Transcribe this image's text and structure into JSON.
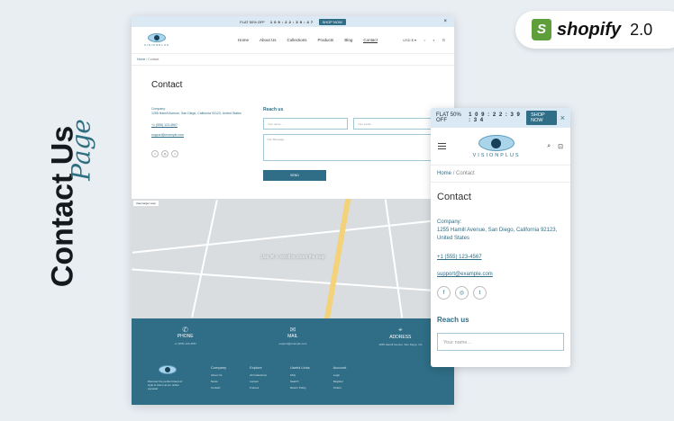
{
  "side": {
    "title": "Contact Us",
    "subtitle": "Page"
  },
  "badge": {
    "brand": "shopify",
    "version": "2.0"
  },
  "desktop": {
    "announcement": {
      "text": "FLAT 50% OFF",
      "countdown": "1 0 9 : 2 2 : 3 9 : 4 7",
      "button": "SHOP NOW",
      "close": "×"
    },
    "logo_text": "VISIONPLUS",
    "menu": [
      "Home",
      "About Us",
      "Collections",
      "Products",
      "Blog",
      "Contact"
    ],
    "tools": [
      "USD $ ▾",
      "○",
      "⌕",
      "⊡"
    ],
    "breadcrumb": {
      "home": "Home",
      "current": "Contact"
    },
    "title": "Contact",
    "info": {
      "label": "Company:",
      "address": "1255 Hamill Avenue, San Diego, California 92123, United States",
      "phone": "+1 (555) 123-4567",
      "email": "support@example.com"
    },
    "social": [
      "f",
      "◎",
      "t"
    ],
    "form": {
      "heading": "Reach us",
      "name_placeholder": "Your name...",
      "email_placeholder": "Your email...",
      "message_placeholder": "Your Message...",
      "send": "SEND"
    },
    "map": {
      "view_larger": "View larger map",
      "message": "Use ⌘ + scroll to zoom the map"
    },
    "footer": {
      "phone": {
        "icon": "✆",
        "label": "PHONE",
        "value": "+1 (555) 123-4567"
      },
      "mail": {
        "icon": "✉",
        "label": "MAIL",
        "value": "support@example.com"
      },
      "address": {
        "icon": "⌖",
        "label": "ADDRESS",
        "value": "1255 Hamill Avenue, San Diego, CA"
      },
      "brand_text": "Discover the perfect blend of style & vision at our online eyewear",
      "company": {
        "heading": "Company",
        "items": [
          "About Us",
          "News",
          "Contact"
        ]
      },
      "explore": {
        "heading": "Explore",
        "items": [
          "All Collections",
          "Lenses",
          "Frames"
        ]
      },
      "useful": {
        "heading": "Useful Links",
        "items": [
          "FAQ",
          "Search",
          "Return Policy"
        ]
      },
      "account": {
        "heading": "Account",
        "items": [
          "Login",
          "Register",
          "Orders"
        ]
      }
    }
  },
  "mobile": {
    "announcement": {
      "text": "FLAT 50% OFF",
      "countdown": "1 0 9 : 2 2 : 3 9 : 3 4",
      "button": "SHOP NOW",
      "close": "×"
    },
    "logo_text": "VISIONPLUS",
    "breadcrumb": {
      "home": "Home",
      "sep": "/",
      "current": "Contact"
    },
    "title": "Contact",
    "info": {
      "label": "Company:",
      "address": "1255 Hamill Avenue, San Diego, California 92123, United States",
      "phone": "+1 (555) 123-4567",
      "email": "support@example.com"
    },
    "social": [
      "f",
      "◎",
      "t"
    ],
    "reach": "Reach us",
    "name_placeholder": "Your name..."
  }
}
